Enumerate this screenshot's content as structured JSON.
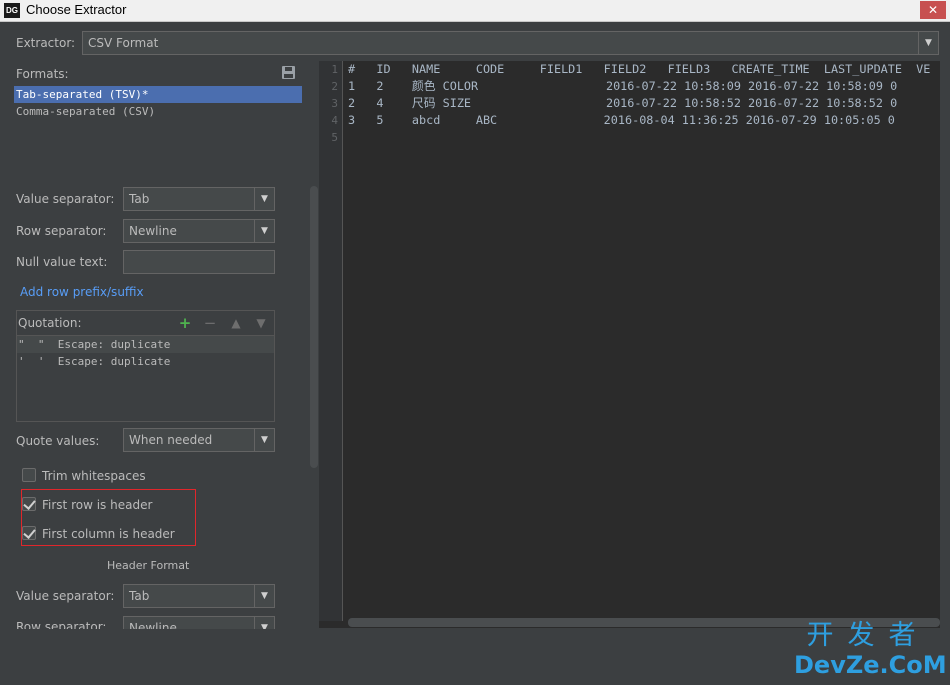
{
  "window": {
    "logo": "DG",
    "title": "Choose Extractor",
    "close": "✕"
  },
  "extractor": {
    "label": "Extractor:",
    "value": "CSV Format"
  },
  "formats": {
    "label": "Formats:",
    "items": [
      {
        "label": "Tab-separated (TSV)*",
        "selected": true
      },
      {
        "label": "Comma-separated (CSV)",
        "selected": false
      }
    ]
  },
  "value_separator": {
    "label": "Value separator:",
    "value": "Tab"
  },
  "row_separator": {
    "label": "Row separator:",
    "value": "Newline"
  },
  "null_value": {
    "label": "Null value text:",
    "value": ""
  },
  "add_prefix_link": "Add row prefix/suffix",
  "quotation": {
    "label": "Quotation:",
    "rows": [
      "\"  \"  Escape: duplicate",
      "'  '  Escape: duplicate"
    ]
  },
  "quote_values": {
    "label": "Quote values:",
    "value": "When needed"
  },
  "checkboxes": {
    "trim": {
      "label": "Trim whitespaces",
      "checked": false
    },
    "first_row": {
      "label": "First row is header",
      "checked": true
    },
    "first_col": {
      "label": "First column is header",
      "checked": true
    }
  },
  "header_format": {
    "title": "Header Format",
    "value_separator": {
      "label": "Value separator:",
      "value": "Tab"
    },
    "row_separator": {
      "label": "Row separator:",
      "value": "Newline"
    }
  },
  "preview": {
    "line_numbers": [
      "1",
      "2",
      "3",
      "4",
      "5"
    ],
    "lines": [
      "#   ID   NAME     CODE     FIELD1   FIELD2   FIELD3   CREATE_TIME  LAST_UPDATE  VE",
      "1   2    颜色 COLOR                  2016-07-22 10:58:09 2016-07-22 10:58:09 0",
      "2   4    尺码 SIZE                   2016-07-22 10:58:52 2016-07-22 10:58:52 0",
      "3   5    abcd     ABC               2016-08-04 11:36:25 2016-07-29 10:05:05 0",
      ""
    ]
  },
  "watermark": {
    "line1": "开发者",
    "line2": "DevZe.CoM"
  }
}
